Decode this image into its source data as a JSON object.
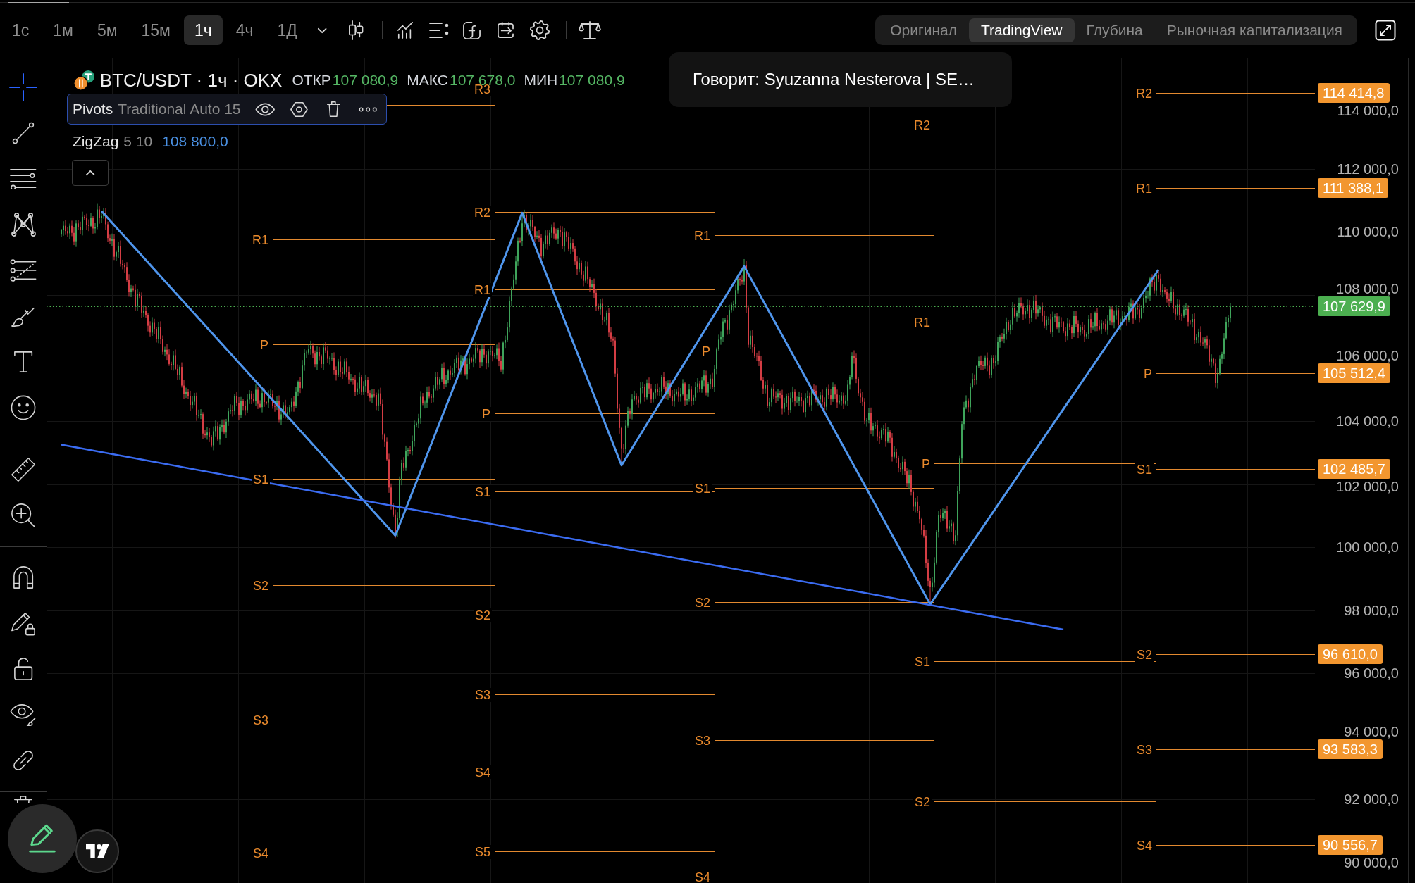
{
  "toolbar": {
    "intervals": [
      {
        "label": "1с",
        "selected": false
      },
      {
        "label": "1м",
        "selected": false
      },
      {
        "label": "5м",
        "selected": false
      },
      {
        "label": "15м",
        "selected": false
      },
      {
        "label": "1ч",
        "selected": true
      },
      {
        "label": "4ч",
        "selected": false
      },
      {
        "label": "1Д",
        "selected": false
      }
    ],
    "views": [
      {
        "label": "Оригинал",
        "selected": false
      },
      {
        "label": "TradingView",
        "selected": true
      },
      {
        "label": "Глубина",
        "selected": false
      },
      {
        "label": "Рыночная капитализация",
        "selected": false
      }
    ]
  },
  "drawing_tools": [
    [
      {
        "selected": true
      },
      {
        "selected": false
      },
      {
        "selected": false
      },
      {
        "selected": false
      },
      {
        "selected": false
      },
      {
        "selected": false
      },
      {
        "selected": false
      },
      {
        "selected": false
      }
    ],
    [
      {
        "selected": false
      },
      {
        "selected": false
      }
    ],
    [
      {
        "selected": false
      },
      {
        "selected": false
      },
      {
        "selected": false
      },
      {
        "selected": false
      },
      {
        "selected": false
      }
    ],
    [
      {
        "selected": false
      }
    ]
  ],
  "legend": {
    "symbol": "BTC/USDT · 1ч · OKX",
    "ohlc": [
      {
        "label": "ОТКР",
        "value": "107 080,9"
      },
      {
        "label": "МАКС",
        "value": "107 678,0"
      },
      {
        "label": "МИН",
        "value": "107 080,9"
      }
    ],
    "indicators": [
      {
        "name": "Pivots",
        "params": "Traditional Auto 15",
        "selected": true
      },
      {
        "name": "ZigZag",
        "params": "5 10",
        "value": "108 800,0",
        "selected": false
      }
    ]
  },
  "tooltip": {
    "text": "Говорит: Syuzanna Nesterova | SE…"
  },
  "chart": {
    "pivot_periods": [
      {
        "labels": [
          "R1",
          "P",
          "S1",
          "S2",
          "S3",
          "S4"
        ]
      },
      {
        "labels": [
          "R3",
          "R2",
          "R1",
          "P",
          "S1",
          "S2",
          "S3",
          "S4",
          "S5"
        ]
      },
      {
        "labels": [
          "R1",
          "P",
          "S1",
          "S2",
          "S3",
          "S4"
        ]
      },
      {
        "labels": [
          "R2",
          "R1",
          "P",
          "S1",
          "S2"
        ]
      },
      {
        "labels": [
          "R2",
          "R1",
          "P",
          "S1",
          "S2",
          "S3",
          "S4"
        ]
      }
    ],
    "price_axis": {
      "ticks": [
        "114 000,0",
        "112 000,0",
        "110 000,0",
        "108 000,0",
        "106 000,0",
        "104 000,0",
        "102 000,0",
        "100 000,0",
        "98 000,0",
        "96 000,0",
        "94 000,0",
        "92 000,0",
        "90 000,0"
      ],
      "tags": [
        {
          "text": "114 414,8",
          "color": "#f2962f"
        },
        {
          "text": "111 388,1",
          "color": "#f2962f"
        },
        {
          "text": "107 629,9",
          "color": "#4caf50"
        },
        {
          "text": "105 512,4",
          "color": "#f2962f"
        },
        {
          "text": "102 485,7",
          "color": "#f2962f"
        },
        {
          "text": "96 610,0",
          "color": "#f2962f"
        },
        {
          "text": "93 583,3",
          "color": "#f2962f"
        },
        {
          "text": "90 556,7",
          "color": "#f2962f"
        }
      ]
    }
  }
}
